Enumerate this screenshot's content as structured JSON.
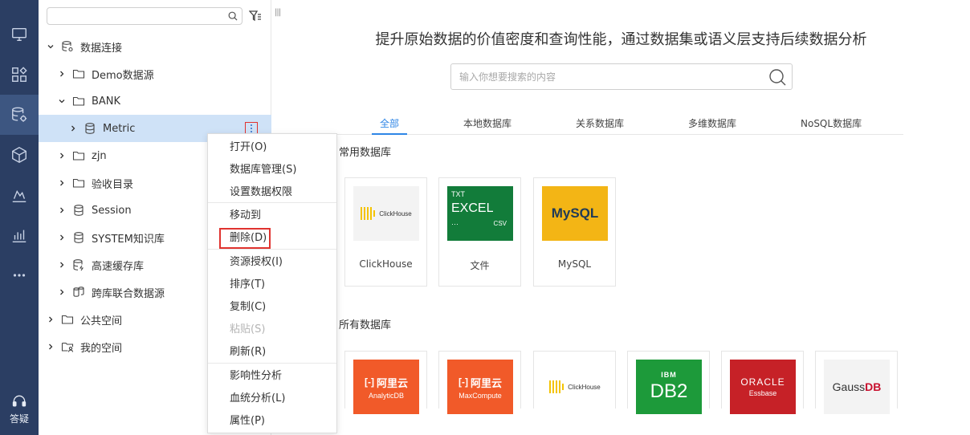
{
  "rail": {
    "items": [
      {
        "icon": "monitor-icon"
      },
      {
        "icon": "dashboard-grid-icon"
      },
      {
        "icon": "database-settings-icon",
        "active": true
      },
      {
        "icon": "cube-icon"
      },
      {
        "icon": "analysis-icon"
      },
      {
        "icon": "bar-chart-icon"
      },
      {
        "icon": "more-dots-icon"
      }
    ],
    "help_label": "答疑"
  },
  "tree": {
    "search_placeholder": "",
    "rows": [
      {
        "label": "数据连接",
        "icon": "database-settings-icon",
        "expanded": true
      },
      {
        "label": "Demo数据源",
        "icon": "folder-icon"
      },
      {
        "label": "BANK",
        "icon": "folder-icon",
        "expanded": true
      },
      {
        "label": "Metric",
        "icon": "database-icon",
        "selected": true
      },
      {
        "label": "zjn",
        "icon": "folder-icon"
      },
      {
        "label": "验收目录",
        "icon": "folder-icon"
      },
      {
        "label": "Session",
        "icon": "database-icon"
      },
      {
        "label": "SYSTEM知识库",
        "icon": "database-icon"
      },
      {
        "label": "高速缓存库",
        "icon": "cache-database-icon"
      },
      {
        "label": "跨库联合数据源",
        "icon": "federated-database-icon"
      },
      {
        "label": "公共空间",
        "icon": "folder-icon"
      },
      {
        "label": "我的空间",
        "icon": "user-folder-icon"
      }
    ]
  },
  "context_menu": {
    "groups": [
      [
        "打开(O)",
        "数据库管理(S)",
        "设置数据权限"
      ],
      [
        "移动到",
        "删除(D)"
      ],
      [
        "资源授权(I)",
        "排序(T)",
        "复制(C)",
        "粘贴(S)",
        "刷新(R)"
      ],
      [
        "影响性分析",
        "血统分析(L)",
        "属性(P)"
      ]
    ],
    "disabled": [
      "粘贴(S)"
    ],
    "highlighted": "删除(D)"
  },
  "main": {
    "headline": "提升原始数据的价值密度和查询性能，通过数据集或语义层支持后续数据分析",
    "search_placeholder": "输入你想要搜索的内容",
    "tabs": [
      "全部",
      "本地数据库",
      "关系数据库",
      "多维数据库",
      "NoSQL数据库"
    ],
    "active_tab": "全部",
    "common_title": "常用数据库",
    "common_cards": [
      {
        "name": "ClickHouse",
        "logo_text": "ClickHouse"
      },
      {
        "name": "文件",
        "logo_lines": [
          "TXT",
          "EXCEL",
          "···",
          "CSV"
        ]
      },
      {
        "name": "MySQL",
        "logo_text": "MySQL"
      }
    ],
    "all_title": "所有数据库",
    "all_cards": [
      {
        "logo_main": "阿里云",
        "logo_sub": "AnalyticDB"
      },
      {
        "logo_main": "阿里云",
        "logo_sub": "MaxCompute"
      },
      {
        "logo_text": "ClickHouse"
      },
      {
        "logo_top": "IBM",
        "logo_main": "DB2"
      },
      {
        "logo_main": "ORACLE",
        "logo_sub": "Essbase"
      },
      {
        "logo_main": "Gauss",
        "logo_accent": "DB"
      }
    ],
    "colors": {
      "accent": "#2f86e6",
      "rail": "#2b3e63",
      "highlight_border": "#e0332f"
    }
  }
}
